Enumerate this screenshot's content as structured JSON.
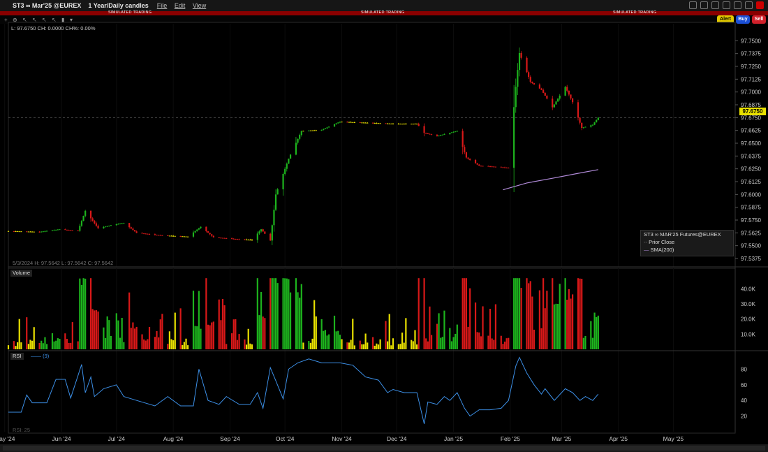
{
  "window": {
    "symbol": "ST3 ∞ Mar'25 @EUREX",
    "period": "1 Year/Daily candles",
    "menu": [
      "File",
      "Edit",
      "View"
    ],
    "sim_label": "SIMULATED TRADING",
    "buttons": {
      "alert": "Alert",
      "buy": "Buy",
      "sell": "Sell"
    }
  },
  "header_readout": "L: 97.6750  CH: 0.0000  CH%: 0.00%",
  "cursor_readout": "5/3/2024  H: 97.5642  L: 97.5642  C: 97.5642",
  "legend": {
    "title": "ST3 ∞ MAR'25 Futures@EUREX",
    "prior_close": "Prior Close",
    "sma": "SMA(200)"
  },
  "volume_label": "Volume",
  "rsi_label": "RSI",
  "rsi_param": "(9)",
  "rsi_readout": "RSI: 25",
  "last_price_label": "97.6750",
  "colors": {
    "up": "#1db31d",
    "down": "#d81818",
    "flat": "#e8e000",
    "sma": "#b08ad8",
    "rsi": "#3c8fe6",
    "last": "#e8e000"
  },
  "chart_data": [
    {
      "type": "candlestick",
      "title": "ST3 ∞ Mar'25 @EUREX",
      "ylim": [
        97.5375,
        97.7625
      ],
      "y_ticks": [
        "97.7500",
        "97.7375",
        "97.7250",
        "97.7125",
        "97.7000",
        "97.6875",
        "97.6750",
        "97.6625",
        "97.6500",
        "97.6375",
        "97.6250",
        "97.6125",
        "97.6000",
        "97.5875",
        "97.5750",
        "97.5625",
        "97.5500",
        "97.5375"
      ],
      "x_ticks": [
        "May '24",
        "Jun '24",
        "Jul '24",
        "Aug '24",
        "Sep '24",
        "Oct '24",
        "Nov '24",
        "Dec '24",
        "Jan '25",
        "Feb '25",
        "Mar '25",
        "Apr '25",
        "May '25"
      ],
      "last_price": 97.675,
      "series": [
        {
          "name": "ST3 ∞ MAR'25 Futures@EUREX",
          "close_anchors": [
            [
              "2024-05-03",
              97.5642
            ],
            [
              "2024-05-20",
              97.5635
            ],
            [
              "2024-05-31",
              97.566
            ],
            [
              "2024-06-10",
              97.5645
            ],
            [
              "2024-06-14",
              97.584
            ],
            [
              "2024-06-21",
              97.567
            ],
            [
              "2024-06-28",
              97.57
            ],
            [
              "2024-07-05",
              97.5722
            ],
            [
              "2024-07-12",
              97.5625
            ],
            [
              "2024-07-26",
              97.56
            ],
            [
              "2024-08-09",
              97.5588
            ],
            [
              "2024-08-16",
              97.5685
            ],
            [
              "2024-08-23",
              97.5582
            ],
            [
              "2024-09-06",
              97.5562
            ],
            [
              "2024-09-13",
              97.5556
            ],
            [
              "2024-09-18",
              97.566
            ],
            [
              "2024-09-23",
              97.555
            ],
            [
              "2024-09-26",
              97.6
            ],
            [
              "2024-10-03",
              97.635
            ],
            [
              "2024-10-10",
              97.662
            ],
            [
              "2024-10-21",
              97.663
            ],
            [
              "2024-10-31",
              97.671
            ],
            [
              "2024-11-14",
              97.67
            ],
            [
              "2024-11-29",
              97.669
            ],
            [
              "2024-12-12",
              97.669
            ],
            [
              "2024-12-16",
              97.66
            ],
            [
              "2024-12-23",
              97.657
            ],
            [
              "2025-01-03",
              97.662
            ],
            [
              "2025-01-08",
              97.636
            ],
            [
              "2025-01-15",
              97.628
            ],
            [
              "2025-01-24",
              97.627
            ],
            [
              "2025-01-31",
              97.626
            ],
            [
              "2025-02-04",
              97.705
            ],
            [
              "2025-02-06",
              97.738
            ],
            [
              "2025-02-12",
              97.71
            ],
            [
              "2025-02-18",
              97.702
            ],
            [
              "2025-02-24",
              97.685
            ],
            [
              "2025-03-03",
              97.705
            ],
            [
              "2025-03-07",
              97.69
            ],
            [
              "2025-03-12",
              97.665
            ],
            [
              "2025-03-18",
              97.668
            ],
            [
              "2025-03-21",
              97.675
            ]
          ]
        },
        {
          "name": "SMA(200)",
          "points": [
            [
              "2025-01-28",
              97.6045
            ],
            [
              "2025-02-10",
              97.6112
            ],
            [
              "2025-02-24",
              97.6158
            ],
            [
              "2025-03-10",
              97.6206
            ],
            [
              "2025-03-21",
              97.6242
            ]
          ]
        }
      ]
    },
    {
      "type": "bar",
      "title": "Volume",
      "ylim": [
        0,
        48000
      ],
      "y_ticks": [
        "40.0K",
        "30.0K",
        "20.0K",
        "10.0K"
      ],
      "y_values": [
        40000,
        30000,
        20000,
        10000
      ]
    },
    {
      "type": "line",
      "title": "RSI",
      "ylim": [
        0,
        100
      ],
      "y_ticks": [
        "80",
        "60",
        "40",
        "20"
      ],
      "y_values": [
        80,
        60,
        40,
        20
      ],
      "series": [
        {
          "name": "RSI(9)",
          "anchors": [
            [
              "2024-05-03",
              25
            ],
            [
              "2024-05-10",
              25
            ],
            [
              "2024-05-13",
              47
            ],
            [
              "2024-05-16",
              37
            ],
            [
              "2024-05-24",
              37
            ],
            [
              "2024-05-29",
              67
            ],
            [
              "2024-06-03",
              67
            ],
            [
              "2024-06-06",
              43
            ],
            [
              "2024-06-12",
              86
            ],
            [
              "2024-06-14",
              50
            ],
            [
              "2024-06-17",
              70
            ],
            [
              "2024-06-19",
              45
            ],
            [
              "2024-06-24",
              55
            ],
            [
              "2024-07-01",
              60
            ],
            [
              "2024-07-05",
              45
            ],
            [
              "2024-07-12",
              40
            ],
            [
              "2024-07-22",
              33
            ],
            [
              "2024-07-29",
              45
            ],
            [
              "2024-08-05",
              33
            ],
            [
              "2024-08-12",
              33
            ],
            [
              "2024-08-15",
              80
            ],
            [
              "2024-08-20",
              40
            ],
            [
              "2024-08-26",
              35
            ],
            [
              "2024-08-30",
              45
            ],
            [
              "2024-09-06",
              35
            ],
            [
              "2024-09-12",
              35
            ],
            [
              "2024-09-16",
              50
            ],
            [
              "2024-09-19",
              30
            ],
            [
              "2024-09-23",
              82
            ],
            [
              "2024-09-26",
              65
            ],
            [
              "2024-09-30",
              42
            ],
            [
              "2024-10-03",
              80
            ],
            [
              "2024-10-08",
              88
            ],
            [
              "2024-10-14",
              93
            ],
            [
              "2024-10-21",
              88
            ],
            [
              "2024-10-31",
              88
            ],
            [
              "2024-11-07",
              85
            ],
            [
              "2024-11-14",
              70
            ],
            [
              "2024-11-21",
              66
            ],
            [
              "2024-11-26",
              50
            ],
            [
              "2024-11-29",
              54
            ],
            [
              "2024-12-05",
              50
            ],
            [
              "2024-12-12",
              50
            ],
            [
              "2024-12-16",
              10
            ],
            [
              "2024-12-18",
              38
            ],
            [
              "2024-12-23",
              35
            ],
            [
              "2024-12-27",
              45
            ],
            [
              "2024-12-30",
              40
            ],
            [
              "2025-01-03",
              50
            ],
            [
              "2025-01-07",
              30
            ],
            [
              "2025-01-10",
              20
            ],
            [
              "2025-01-15",
              28
            ],
            [
              "2025-01-21",
              28
            ],
            [
              "2025-01-27",
              30
            ],
            [
              "2025-01-31",
              40
            ],
            [
              "2025-02-04",
              84
            ],
            [
              "2025-02-06",
              95
            ],
            [
              "2025-02-10",
              75
            ],
            [
              "2025-02-14",
              60
            ],
            [
              "2025-02-18",
              48
            ],
            [
              "2025-02-20",
              55
            ],
            [
              "2025-02-25",
              40
            ],
            [
              "2025-03-03",
              55
            ],
            [
              "2025-03-07",
              50
            ],
            [
              "2025-03-11",
              40
            ],
            [
              "2025-03-14",
              45
            ],
            [
              "2025-03-18",
              40
            ],
            [
              "2025-03-21",
              48
            ]
          ]
        }
      ]
    }
  ]
}
